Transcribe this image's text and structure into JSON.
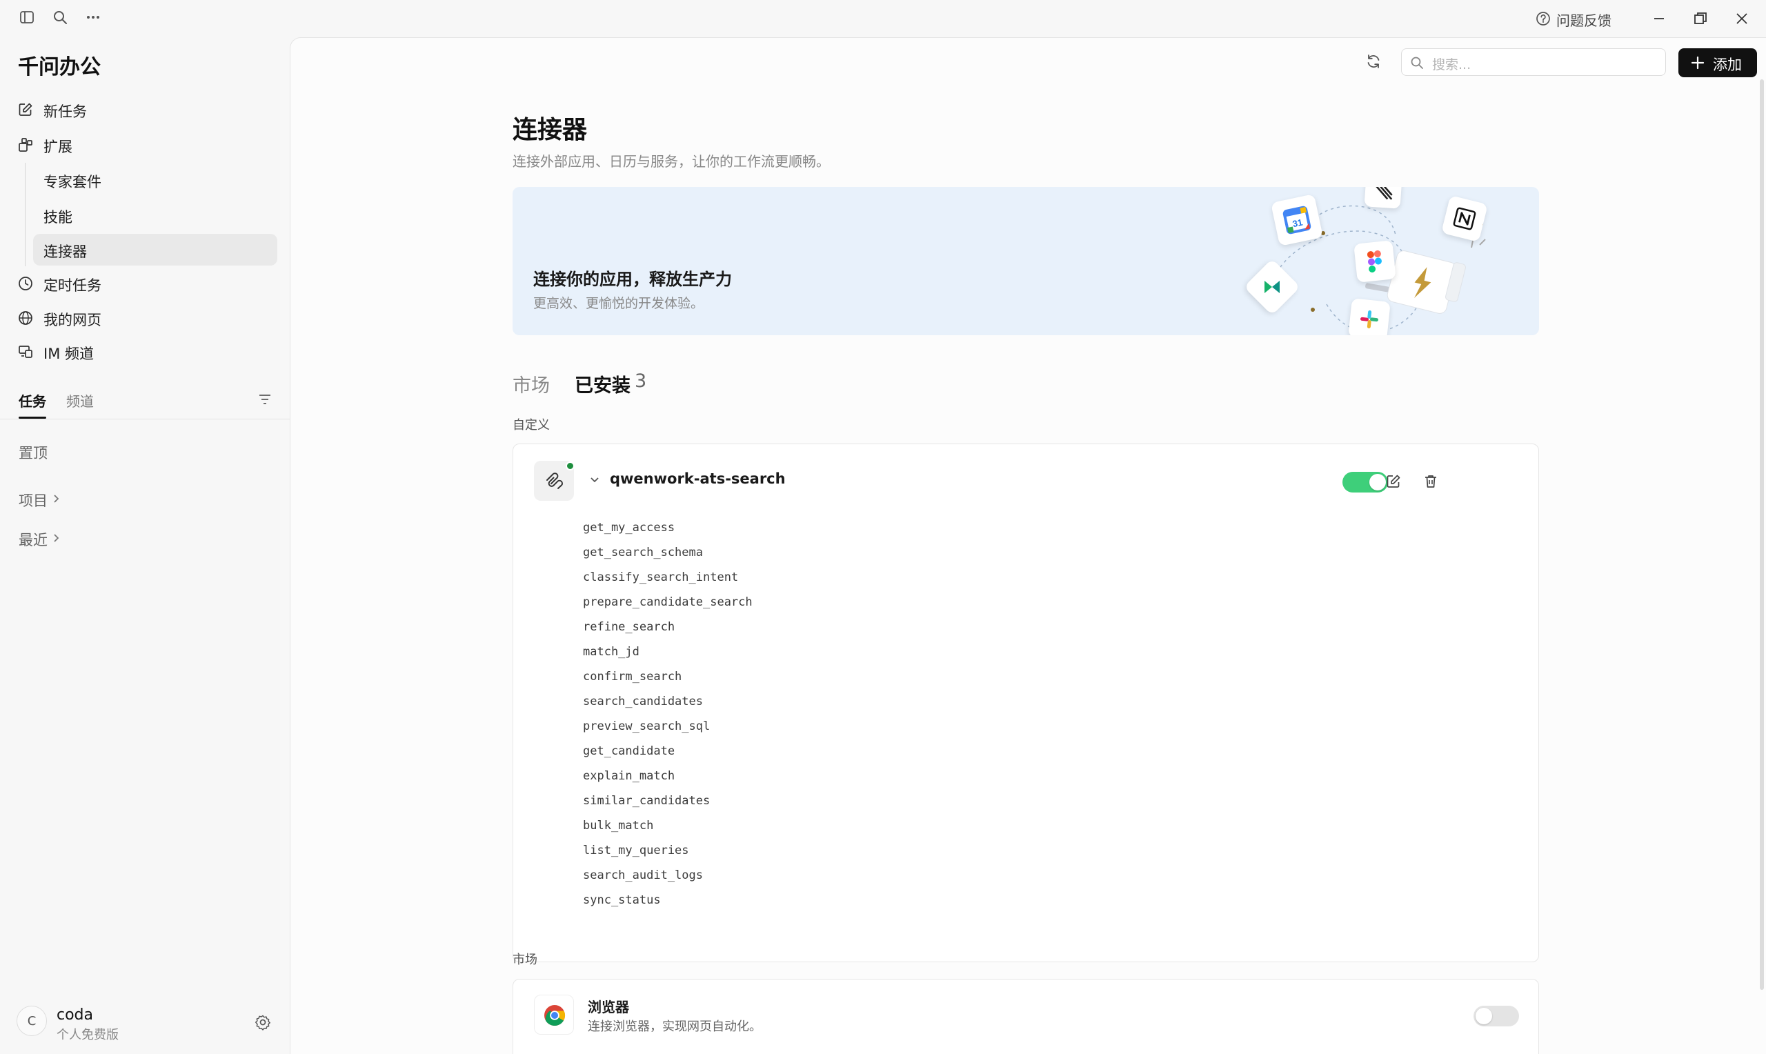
{
  "titlebar": {
    "feedback_label": "问题反馈"
  },
  "sidebar": {
    "app_title": "千问办公",
    "nav": {
      "new_task": "新任务",
      "extensions": "扩展",
      "expert_kits": "专家套件",
      "skills": "技能",
      "connectors": "连接器",
      "scheduled": "定时任务",
      "my_pages": "我的网页",
      "im_channel": "IM 频道"
    },
    "tabs": {
      "tasks": "任务",
      "channels": "频道"
    },
    "pinned_label": "置顶",
    "projects_label": "项目",
    "recent_label": "最近",
    "user": {
      "avatar_letter": "C",
      "name": "coda",
      "plan": "个人免费版"
    }
  },
  "header": {
    "search_placeholder": "搜索...",
    "add_label": "添加"
  },
  "page": {
    "title": "连接器",
    "subtitle": "连接外部应用、日历与服务，让你的工作流更顺畅。",
    "banner": {
      "title": "连接你的应用，释放生产力",
      "subtitle": "更高效、更愉悦的开发体验。",
      "calendar_day": "31"
    },
    "tabs": {
      "market": "市场",
      "installed": "已安装",
      "installed_count": "3"
    },
    "custom_section_label": "自定义",
    "market_section_label": "市场"
  },
  "connector": {
    "name": "qwenwork-ats-search",
    "enabled": true,
    "status_color": "#1e8e3e",
    "tools": [
      "get_my_access",
      "get_search_schema",
      "classify_search_intent",
      "prepare_candidate_search",
      "refine_search",
      "match_jd",
      "confirm_search",
      "search_candidates",
      "preview_search_sql",
      "get_candidate",
      "explain_match",
      "similar_candidates",
      "bulk_match",
      "list_my_queries",
      "search_audit_logs",
      "sync_status"
    ]
  },
  "market_item": {
    "name": "浏览器",
    "description": "连接浏览器，实现网页自动化。",
    "enabled": false
  },
  "colors": {
    "accent_green": "#3ecf7a",
    "primary_button": "#111111",
    "banner_bg": "#e8f1fb"
  }
}
